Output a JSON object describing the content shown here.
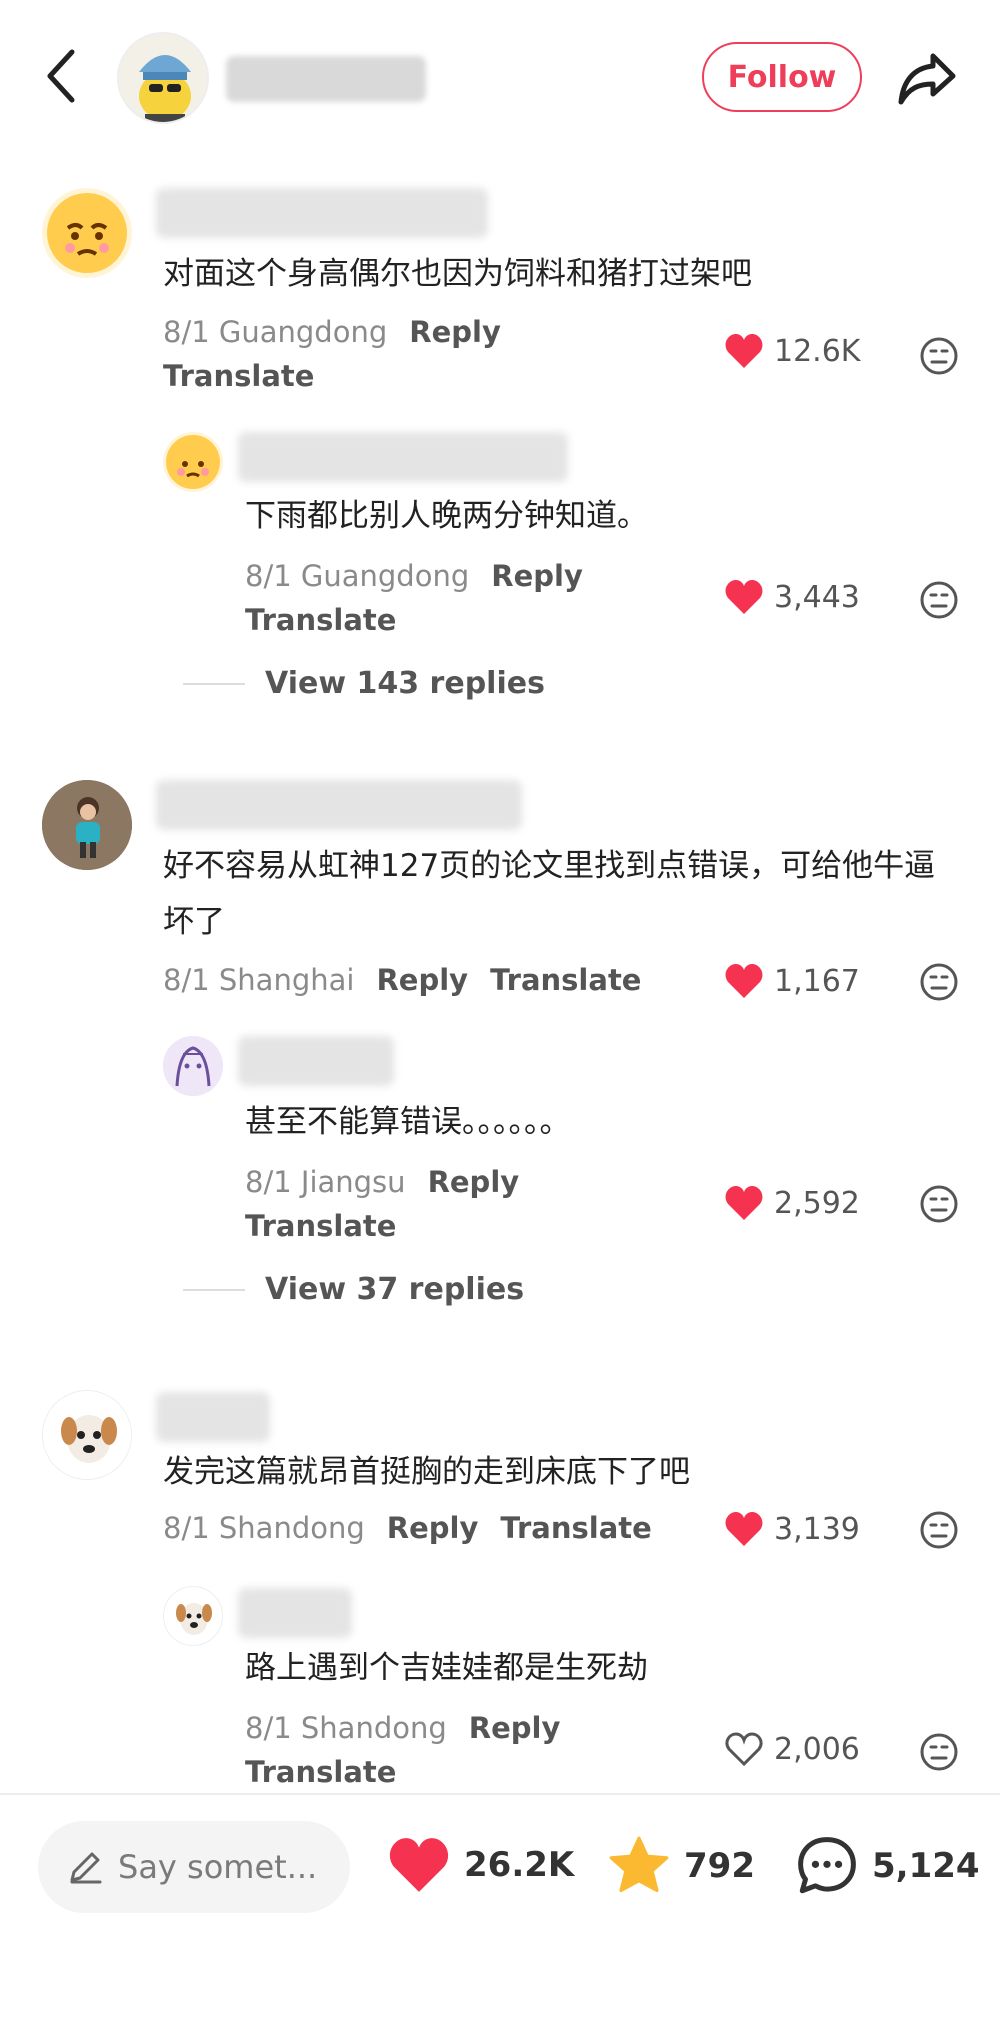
{
  "header": {
    "follow_label": "Follow"
  },
  "comments": [
    {
      "text": "对面这个身高偶尔也因为饲料和猪打过架吧",
      "date_location": "8/1 Guangdong",
      "reply": "Reply",
      "translate": "Translate",
      "likes": "12.6K",
      "liked": true,
      "sub": {
        "text": "下雨都比别人晚两分钟知道。",
        "date_location": "8/1 Guangdong",
        "reply": "Reply",
        "translate": "Translate",
        "likes": "3,443",
        "liked": true
      },
      "view_replies": "View 143 replies"
    },
    {
      "text": "好不容易从虹神127页的论文里找到点错误，可给他牛逼坏了",
      "date_location": "8/1 Shanghai",
      "reply": "Reply",
      "translate": "Translate",
      "likes": "1,167",
      "liked": true,
      "sub": {
        "text": "甚至不能算错误。。。。。。",
        "date_location": "8/1 Jiangsu",
        "reply": "Reply",
        "translate": "Translate",
        "likes": "2,592",
        "liked": true
      },
      "view_replies": "View 37 replies"
    },
    {
      "text": "发完这篇就昂首挺胸的走到床底下了吧",
      "date_location": "8/1 Shandong",
      "reply": "Reply",
      "translate": "Translate",
      "likes": "3,139",
      "liked": true,
      "sub": {
        "text": "路上遇到个吉娃娃都是生死劫",
        "date_location": "8/1 Shandong",
        "reply": "Reply",
        "translate": "Translate",
        "likes": "2,006",
        "liked": false
      }
    }
  ],
  "bottom_bar": {
    "input_placeholder": "Say somet...",
    "likes": "26.2K",
    "stars": "792",
    "comments": "5,124"
  },
  "colors": {
    "accent": "#ee3e5a",
    "like": "#f5324f",
    "star": "#fbb931"
  },
  "icons": [
    "back-arrow-icon",
    "share-icon",
    "heart-icon",
    "heart-outline-icon",
    "face-react-icon",
    "pencil-icon",
    "star-icon",
    "chat-bubble-icon"
  ]
}
